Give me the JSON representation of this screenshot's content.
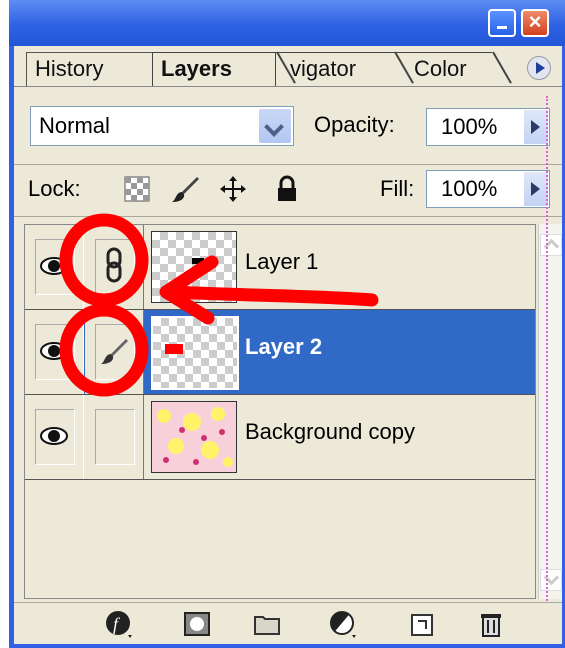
{
  "tabs": [
    {
      "label": "History"
    },
    {
      "label": "Layers"
    },
    {
      "label": "vigator"
    },
    {
      "label": "Color"
    }
  ],
  "blend": {
    "mode": "Normal"
  },
  "opacity": {
    "label": "Opacity:",
    "value": "100%"
  },
  "lock": {
    "label": "Lock:"
  },
  "fill": {
    "label": "Fill:",
    "value": "100%"
  },
  "layers": [
    {
      "name": "Layer 1",
      "selected": false
    },
    {
      "name": "Layer 2",
      "selected": true
    },
    {
      "name": "Background copy",
      "selected": false
    }
  ],
  "colors": {
    "selection": "#3169c6",
    "annotation": "#ff0000",
    "title_bar": "#2f62e4"
  },
  "icons": [
    "eye-icon",
    "link-icon",
    "brush-icon",
    "lock-transparency-icon",
    "lock-move-icon",
    "lock-all-icon",
    "layer-style-icon",
    "mask-icon",
    "folder-icon",
    "adjustment-icon",
    "new-layer-icon",
    "trash-icon"
  ]
}
